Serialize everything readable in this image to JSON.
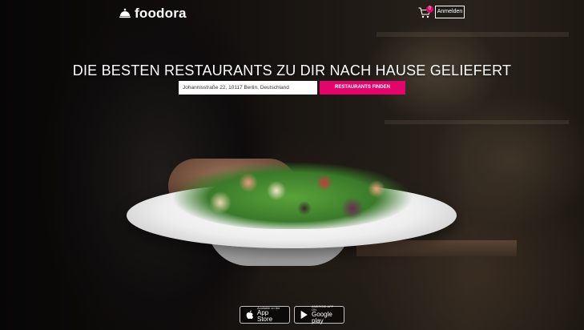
{
  "header": {
    "logo_text": "foodora",
    "cart_count": "0",
    "login_label": "Anmelden"
  },
  "hero": {
    "headline": "DIE BESTEN RESTAURANTS ZU DIR NACH HAUSE GELIEFERT",
    "address_value": "Johannisstraße 22, 10117 Berlin, Deutschland",
    "search_button_label": "RESTAURANTS FINDEN"
  },
  "store_badges": {
    "apple_small": "Available on the",
    "apple_big": "App Store",
    "google_small": "ANDROID APP ON",
    "google_big": "Google play"
  },
  "colors": {
    "accent": "#e4046b",
    "text": "#ffffff"
  },
  "icons": [
    "logo-cloche-icon",
    "shopping-cart-icon",
    "apple-icon",
    "google-play-icon"
  ]
}
